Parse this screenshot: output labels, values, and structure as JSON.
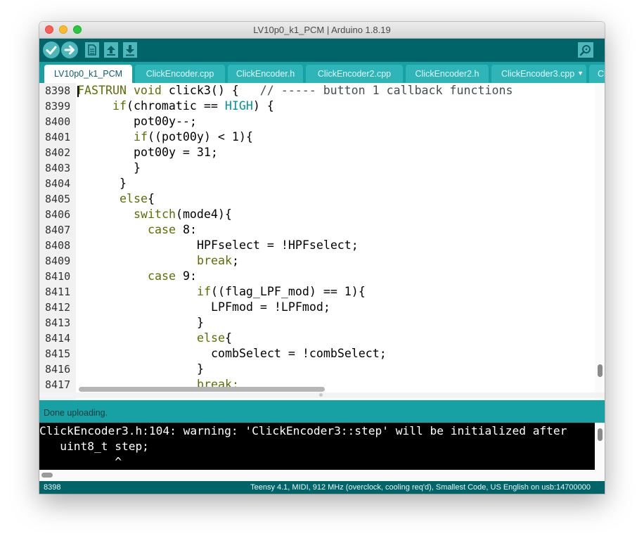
{
  "window": {
    "title": "LV10p0_k1_PCM | Arduino 1.8.19"
  },
  "toolbar": {
    "verify_icon": "checkmark-icon",
    "upload_icon": "arrow-right-icon",
    "new_icon": "new-file-icon",
    "open_icon": "arrow-up-icon",
    "save_icon": "arrow-down-icon",
    "serial_icon": "magnifier-icon"
  },
  "tabs": [
    {
      "label": "LV10p0_k1_PCM",
      "active": true
    },
    {
      "label": "ClickEncoder.cpp"
    },
    {
      "label": "ClickEncoder.h"
    },
    {
      "label": "ClickEncoder2.cpp"
    },
    {
      "label": "ClickEncoder2.h"
    },
    {
      "label": "ClickEncoder3.cpp"
    },
    {
      "label": "Cl"
    }
  ],
  "editor": {
    "lines": [
      {
        "n": "8398"
      },
      {
        "n": "8399"
      },
      {
        "n": "8400"
      },
      {
        "n": "8401"
      },
      {
        "n": "8402"
      },
      {
        "n": "8403"
      },
      {
        "n": "8404"
      },
      {
        "n": "8405"
      },
      {
        "n": "8406"
      },
      {
        "n": "8407"
      },
      {
        "n": "8408"
      },
      {
        "n": "8409"
      },
      {
        "n": "8410"
      },
      {
        "n": "8411"
      },
      {
        "n": "8412"
      },
      {
        "n": "8413"
      },
      {
        "n": "8414"
      },
      {
        "n": "8415"
      },
      {
        "n": "8416"
      },
      {
        "n": "8417"
      }
    ],
    "code": {
      "l0_a": "FASTRUN",
      "l0_b": "void",
      "l0_c": " click3() {   ",
      "l0_d": "// ----- button 1 callback functions",
      "l1_a": "if",
      "l1_b": "(chromatic == ",
      "l1_c": "HIGH",
      "l1_d": ") {",
      "l2": "pot00y--;",
      "l3_a": "if",
      "l3_b": "((pot00y) < 1){",
      "l4": "pot00y = 31;",
      "l5": "}",
      "l6": "}",
      "l7_a": "else",
      "l7_b": "{",
      "l8_a": "switch",
      "l8_b": "(mode4){",
      "l9_a": "case",
      "l9_b": " 8:",
      "l10": "HPFselect = !HPFselect;",
      "l11_a": "break",
      "l11_b": ";",
      "l12_a": "case",
      "l12_b": " 9:",
      "l13_a": "if",
      "l13_b": "((flag_LPF_mod) == 1){",
      "l14": "LPFmod = !LPFmod;",
      "l15": "}",
      "l16_a": "else",
      "l16_b": "{",
      "l17": "combSelect = !combSelect;",
      "l18": "}",
      "l19": "break;"
    }
  },
  "status": {
    "message": "Done uploading."
  },
  "console": {
    "line1": "ClickEncoder3.h:104: warning: 'ClickEncoder3::step' will be initialized after",
    "line2": "   uint8_t step;",
    "line3": "           ^"
  },
  "footer": {
    "line_number": "8398",
    "board_info": "Teensy 4.1, MIDI, 912 MHz (overclock, cooling req'd), Smallest Code, US English on usb:14700000"
  },
  "colors": {
    "teal_dark": "#006468",
    "teal": "#17a1a5",
    "keyword": "#5e6d03",
    "function": "#d35400",
    "constant": "#00979c"
  }
}
